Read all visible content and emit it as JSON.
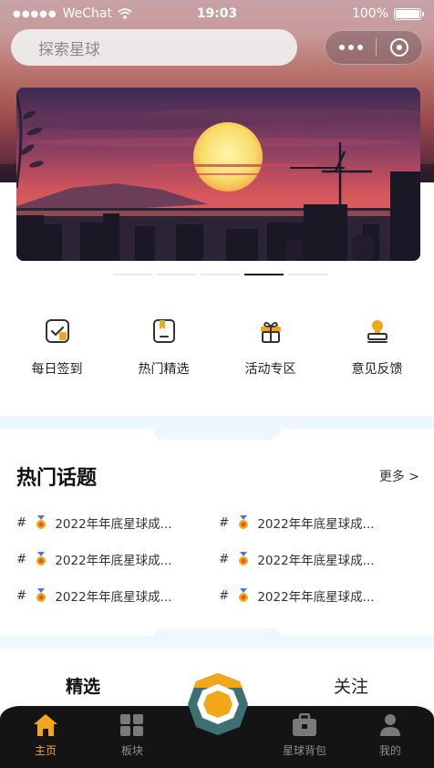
{
  "status_bar": {
    "carrier": "WeChat",
    "time": "19:03",
    "battery": "100%",
    "battery_level": 1.0
  },
  "search": {
    "placeholder": "探索星球"
  },
  "banner": {
    "slide_count": 5,
    "active_index": 3
  },
  "quick_menu": [
    {
      "label": "每日签到",
      "icon": "checkin-icon"
    },
    {
      "label": "热门精选",
      "icon": "bookmark-icon"
    },
    {
      "label": "活动专区",
      "icon": "gift-icon"
    },
    {
      "label": "意见反馈",
      "icon": "feedback-stamp-icon"
    }
  ],
  "hot_topics": {
    "title": "热门话题",
    "more_label": "更多 >",
    "items": [
      {
        "hash": "#",
        "text": "2022年年底星球成..."
      },
      {
        "hash": "#",
        "text": "2022年年底星球成..."
      },
      {
        "hash": "#",
        "text": "2022年年底星球成..."
      },
      {
        "hash": "#",
        "text": "2022年年底星球成..."
      },
      {
        "hash": "#",
        "text": "2022年年底星球成..."
      },
      {
        "hash": "#",
        "text": "2022年年底星球成..."
      }
    ]
  },
  "feed_tabs": {
    "selected": "精选",
    "follow": "关注"
  },
  "tabbar": {
    "home": "主页",
    "board": "板块",
    "bag": "星球背包",
    "mine": "我的"
  },
  "colors": {
    "accent": "#f0a81a",
    "tabbar_bg": "#141414",
    "divider": "#eef7fd",
    "center_teal": "#3e6f72"
  }
}
